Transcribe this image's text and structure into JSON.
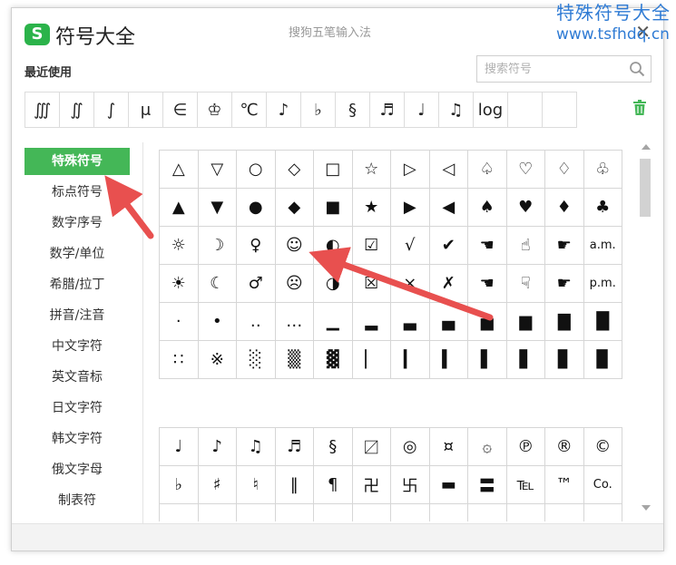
{
  "watermark": {
    "line1": "特殊符号大全",
    "line2": "www.tsfhdq.cn"
  },
  "window": {
    "title": "符号大全",
    "logo_letter": "S",
    "ime_name": "搜狗五笔输入法",
    "close": "✕"
  },
  "recent": {
    "label": "最近使用",
    "items": [
      "∭",
      "∬",
      "∫",
      "μ",
      "∈",
      "♔",
      "℃",
      "♪",
      "♭",
      "§",
      "♬",
      "♩",
      "♫",
      "log",
      "",
      ""
    ]
  },
  "search": {
    "placeholder": "搜索符号"
  },
  "icons": {
    "search": "search-icon",
    "trash": "trash-icon",
    "close": "close-icon"
  },
  "colors": {
    "accent": "#44b757",
    "arrow": "#e8504f",
    "watermark": "#2f7bd4"
  },
  "sidebar": {
    "active_index": 0,
    "items": [
      {
        "label": "特殊符号"
      },
      {
        "label": "标点符号"
      },
      {
        "label": "数字序号"
      },
      {
        "label": "数学/单位"
      },
      {
        "label": "希腊/拉丁"
      },
      {
        "label": "拼音/注音"
      },
      {
        "label": "中文字符"
      },
      {
        "label": "英文音标"
      },
      {
        "label": "日文字符"
      },
      {
        "label": "韩文字符"
      },
      {
        "label": "俄文字母"
      },
      {
        "label": "制表符"
      }
    ]
  },
  "symbols_group1": [
    "△",
    "▽",
    "○",
    "◇",
    "□",
    "☆",
    "▷",
    "◁",
    "♤",
    "♡",
    "♢",
    "♧",
    "▲",
    "▼",
    "●",
    "◆",
    "■",
    "★",
    "▶",
    "◀",
    "♠",
    "♥",
    "♦",
    "♣",
    "☼",
    "☽",
    "♀",
    "☺",
    "◐",
    "☑",
    "√",
    "✔",
    "☚",
    "☝",
    "☛",
    "a.m.",
    "☀",
    "☾",
    "♂",
    "☹",
    "◑",
    "☒",
    "×",
    "✗",
    "☚",
    "☟",
    "☛",
    "p.m.",
    "·",
    "•",
    "‥",
    "…",
    "▁",
    "▂",
    "▃",
    "▄",
    "▅",
    "▆",
    "▇",
    "█",
    "∷",
    "※",
    "░",
    "▒",
    "▓",
    "▏",
    "▎",
    "▍",
    "▌",
    "▋",
    "▊",
    "▉"
  ],
  "symbols_group2": [
    "♩",
    "♪",
    "♫",
    "♬",
    "§",
    "〼",
    "◎",
    "¤",
    "۞",
    "℗",
    "®",
    "©",
    "♭",
    "♯",
    "♮",
    "‖",
    "¶",
    "卍",
    "卐",
    "▬",
    "〓",
    "℡",
    "™",
    "Co.",
    "",
    "",
    "",
    "",
    "",
    "",
    "",
    "",
    "",
    "",
    "",
    ""
  ]
}
